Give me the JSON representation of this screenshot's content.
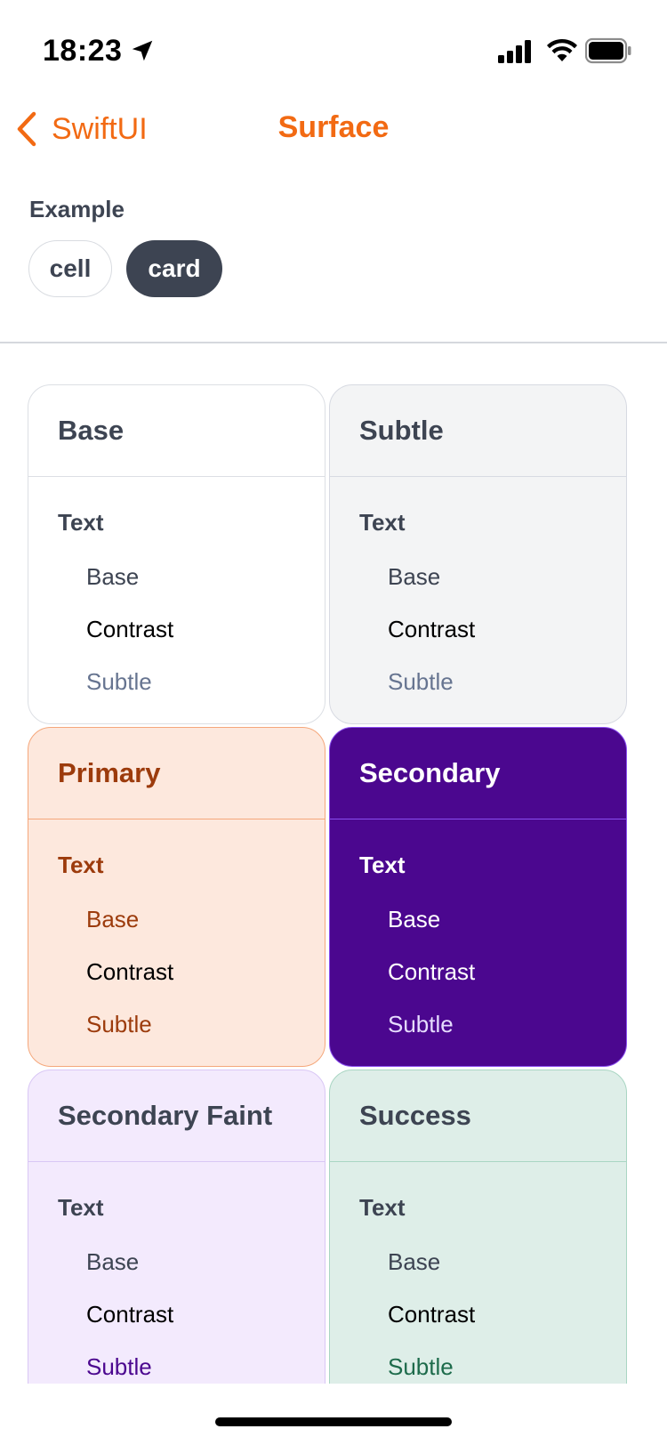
{
  "status_bar": {
    "time": "18:23",
    "icons": [
      "location-arrow-icon",
      "cellular-signal-icon",
      "wifi-icon",
      "battery-icon"
    ]
  },
  "nav": {
    "back_label": "SwiftUI",
    "title": "Surface",
    "accent_color": "#f26a13"
  },
  "example": {
    "label": "Example",
    "options": [
      {
        "label": "cell",
        "selected": false
      },
      {
        "label": "card",
        "selected": true
      }
    ]
  },
  "cards": [
    {
      "title": "Base",
      "text_label": "Text",
      "items": [
        "Base",
        "Contrast",
        "Subtle"
      ],
      "colors": {
        "bg": "#ffffff",
        "border": "#dcdfe4",
        "title": "#3d4452",
        "label": "#3d4452",
        "base": "#3d4452",
        "contrast": "#000000",
        "subtle": "#667490"
      }
    },
    {
      "title": "Subtle",
      "text_label": "Text",
      "items": [
        "Base",
        "Contrast",
        "Subtle"
      ],
      "colors": {
        "bg": "#f3f4f5",
        "border": "#d7dae2",
        "title": "#3d4452",
        "label": "#3d4452",
        "base": "#3d4452",
        "contrast": "#000000",
        "subtle": "#667490"
      }
    },
    {
      "title": "Primary",
      "text_label": "Text",
      "items": [
        "Base",
        "Contrast",
        "Subtle"
      ],
      "colors": {
        "bg": "#fde8dd",
        "border": "#f5a77b",
        "title": "#9c3b0c",
        "label": "#9c3b0c",
        "base": "#9c3b0c",
        "contrast": "#000000",
        "subtle": "#9c3b0c"
      }
    },
    {
      "title": "Secondary",
      "text_label": "Text",
      "items": [
        "Base",
        "Contrast",
        "Subtle"
      ],
      "colors": {
        "bg": "#4b078f",
        "border": "#8a4ef0",
        "title": "#ffffff",
        "label": "#ffffff",
        "base": "#ffffff",
        "contrast": "#ffffff",
        "subtle": "#e6dcff"
      }
    },
    {
      "title": "Secondary Faint",
      "text_label": "Text",
      "items": [
        "Base",
        "Contrast",
        "Subtle"
      ],
      "colors": {
        "bg": "#f3eafd",
        "border": "#d9c7f5",
        "title": "#3d4452",
        "label": "#3d4452",
        "base": "#3d4452",
        "contrast": "#000000",
        "subtle": "#4b078f"
      }
    },
    {
      "title": "Success",
      "text_label": "Text",
      "items": [
        "Base",
        "Contrast",
        "Subtle"
      ],
      "colors": {
        "bg": "#deeee8",
        "border": "#a9d6c3",
        "title": "#3d4452",
        "label": "#3d4452",
        "base": "#3d4452",
        "contrast": "#000000",
        "subtle": "#1d6b4b"
      }
    }
  ]
}
